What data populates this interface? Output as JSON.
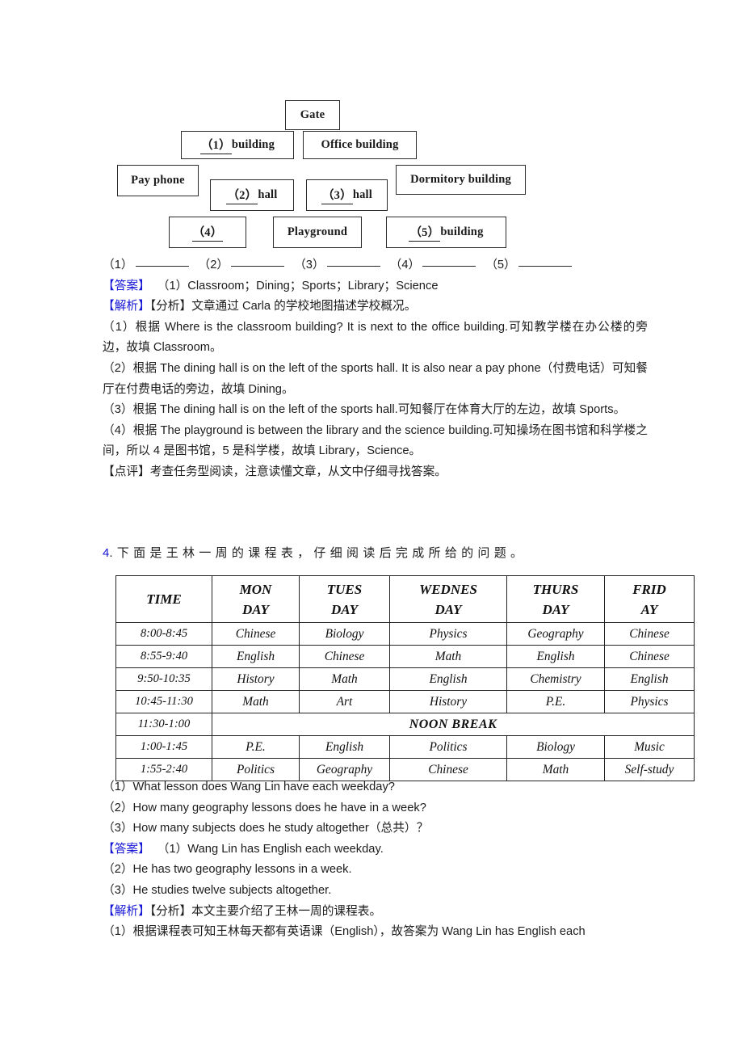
{
  "diagram": {
    "name": "school-map-diagram",
    "boxes": [
      {
        "id": "gate",
        "label": "Gate"
      },
      {
        "id": "b1",
        "prefix": "（1）",
        "suffix": "building"
      },
      {
        "id": "office",
        "label": "Office building"
      },
      {
        "id": "payphone",
        "label": "Pay phone"
      },
      {
        "id": "dormitory",
        "label": "Dormitory building"
      },
      {
        "id": "b2",
        "prefix": "（2）",
        "suffix": "hall"
      },
      {
        "id": "b3",
        "prefix": "（3）",
        "suffix": "hall"
      },
      {
        "id": "b4",
        "prefix": "（4）",
        "suffix": ""
      },
      {
        "id": "playground",
        "label": "Playground"
      },
      {
        "id": "b5",
        "prefix": "（5）",
        "suffix": "building"
      }
    ]
  },
  "blanks_row": {
    "n1": "（1）",
    "n2": "（2）",
    "n3": "（3）",
    "n4": "（4）",
    "n5": "（5）"
  },
  "section3": {
    "answer_label": "【答案】",
    "answer_text": "（1）Classroom；Dining；Sports；Library；Science",
    "analysis_label": "【解析】",
    "analysis_sub_label": "【分析】",
    "analysis_text": "文章通过 Carla 的学校地图描述学校概况。",
    "explanations": [
      "（1）根据 Where is the classroom building? It is next to the office building.可知教学楼在办公楼的旁边，故填 Classroom。",
      "（2）根据 The dining hall is on the left of the sports hall. It is also near a pay phone（付费电话）可知餐厅在付费电话的旁边，故填 Dining。",
      "（3）根据 The dining hall is on the left of the sports hall.可知餐厅在体育大厅的左边，故填 Sports。",
      "（4）根据 The playground is between the library and the science building.可知操场在图书馆和科学楼之间，所以 4 是图书馆，5 是科学楼，故填 Library，Science。"
    ],
    "comment_label": "【点评】",
    "comment_text": "考查任务型阅读，注意读懂文章，从文中仔细寻找答案。"
  },
  "section4": {
    "number": "4",
    "heading_punct": ".",
    "heading_text": "下面是王林一周的课程表，仔细阅读后完成所给的问题。",
    "timetable": {
      "headers": [
        "TIME",
        "MON DAY",
        "TUES DAY",
        "WEDNES DAY",
        "THURS DAY",
        "FRID AY"
      ],
      "headers_lines": [
        [
          "TIME",
          ""
        ],
        [
          "MON",
          "DAY"
        ],
        [
          "TUES",
          "DAY"
        ],
        [
          "WEDNES",
          "DAY"
        ],
        [
          "THURS",
          "DAY"
        ],
        [
          "FRID",
          "AY"
        ]
      ],
      "noon_break_label": "NOON    BREAK",
      "rows": [
        {
          "time": "8:00-8:45",
          "cells": [
            "Chinese",
            "Biology",
            "Physics",
            "Geography",
            "Chinese"
          ]
        },
        {
          "time": "8:55-9:40",
          "cells": [
            "English",
            "Chinese",
            "Math",
            "English",
            "Chinese"
          ]
        },
        {
          "time": "9:50-10:35",
          "cells": [
            "History",
            "Math",
            "English",
            "Chemistry",
            "English"
          ]
        },
        {
          "time": "10:45-11:30",
          "cells": [
            "Math",
            "Art",
            "History",
            "P.E.",
            "Physics"
          ]
        },
        {
          "time": "11:30-1:00",
          "noon": true,
          "cells": []
        },
        {
          "time": "1:00-1:45",
          "cells": [
            "P.E.",
            "English",
            "Politics",
            "Biology",
            "Music"
          ]
        },
        {
          "time": "1:55-2:40",
          "cells": [
            "Politics",
            "Geography",
            "Chinese",
            "Math",
            "Self-study"
          ]
        }
      ]
    },
    "questions": [
      "（1）What lesson does Wang Lin have each weekday?",
      "（2）How many geography lessons does he have in a week?",
      "（3）How many subjects does he study altogether（总共）？"
    ],
    "answer_label": "【答案】",
    "answers": [
      "（1）Wang Lin has English each weekday.",
      "（2）He has two geography lessons in a week.",
      "（3）He studies twelve subjects altogether."
    ],
    "analysis_label": "【解析】",
    "analysis_sub_label": "【分析】",
    "analysis_text": "本文主要介绍了王林一周的课程表。",
    "explanations": [
      "（1）根据课程表可知王林每天都有英语课（English），故答案为 Wang Lin has English each"
    ]
  },
  "colors": {
    "blue_label": "#1515d6",
    "text": "#1c1c1c",
    "box_border": "#2b2b2b",
    "table_border": "#232323"
  }
}
